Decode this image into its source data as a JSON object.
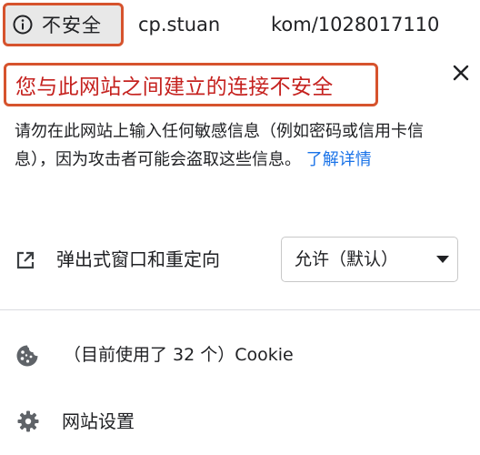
{
  "address_bar": {
    "security_label": "不安全",
    "url_host": "cp.stuan",
    "url_path": "kom/1028017110"
  },
  "popup": {
    "warning_title": "您与此网站之间建立的连接不安全",
    "description": "请勿在此网站上输入任何敏感信息（例如密码或信用卡信息），因为攻击者可能会盗取这些信息。",
    "learn_more": "了解详情",
    "close_icon": "close-icon",
    "permissions": {
      "popups_label": "弹出式窗口和重定向",
      "popups_value": "允许（默认）"
    },
    "cookies_label": "（目前使用了 32 个）Cookie",
    "site_settings_label": "网站设置"
  },
  "colors": {
    "highlight_border": "#d6532d",
    "warning_text": "#c5221f",
    "link": "#1a73e8"
  }
}
